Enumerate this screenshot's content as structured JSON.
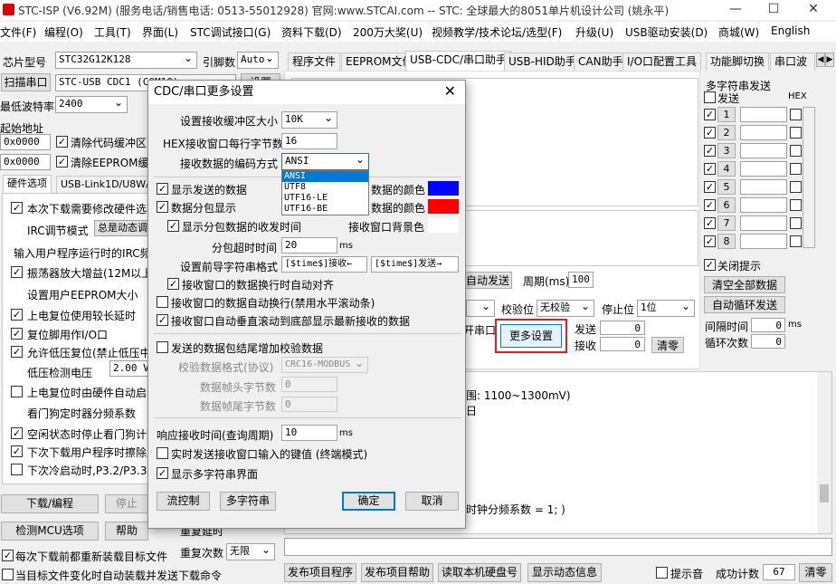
{
  "window": {
    "title": "STC-ISP (V6.92M) (服务电话/销售电话: 0513-55012928) 官网:www.STCAI.com  -- STC: 全球最大的8051单片机设计公司 (姚永平)",
    "min": "—",
    "max": "☐",
    "close": "✕"
  },
  "menu": [
    "文件(F)",
    "编程(O)",
    "工具(T)",
    "界面(L)",
    "STC调试接口(G)",
    "资料下载(D)",
    "200万大奖(U)",
    "视频教学/技术论坛/选型(F)",
    "升级(U)",
    "USB驱动安装(D)",
    "商城(W)",
    "English"
  ],
  "left": {
    "chip_label": "芯片型号",
    "chip_value": "STC32G12K128",
    "pin_label": "引脚数",
    "pin_value": "Auto",
    "scan_btn": "扫描串口",
    "port_value": "STC-USB CDC1 (COM10)",
    "setup_btn": "设置",
    "baud_label": "最低波特率",
    "baud_value": "2400",
    "start_label": "起始地址",
    "addr1": "0x0000",
    "clear_code": "清除代码缓冲区",
    "addr2": "0x0000",
    "clear_eeprom": "清除EEPROM缓冲区",
    "hw_tab": "硬件选项",
    "usb_tab": "USB-Link1D/U8W/U",
    "opts": [
      {
        "t": "本次下载需要修改硬件选项",
        "c": true
      },
      {
        "t": "IRC调节模式",
        "c": null
      },
      {
        "t": "输入用户程序运行时的IRC频率",
        "c": null
      },
      {
        "t": "振荡器放大增益(12M以上建议)",
        "c": true
      },
      {
        "t": "设置用户EEPROM大小",
        "c": null
      },
      {
        "t": "上电复位使用较长延时",
        "c": true
      },
      {
        "t": "复位脚用作I/O口",
        "c": true
      },
      {
        "t": "允许低压复位(禁止低压中断)",
        "c": true
      },
      {
        "t": "低压检测电压",
        "c": null
      },
      {
        "t": "上电复位时由硬件自动启动看门狗",
        "c": false
      },
      {
        "t": "看门狗定时器分频系数",
        "c": null
      },
      {
        "t": "空闲状态时停止看门狗计数",
        "c": true
      },
      {
        "t": "下次下载用户程序时擦除用户EEPROM区",
        "c": true
      },
      {
        "t": "下次冷启动时,P3.2/P3.3为0/0才可下载程序",
        "c": false
      }
    ],
    "irc_mode": "总是动态调节",
    "lvd_value": "2.00 V",
    "download_btn": "下载/编程",
    "stop_btn": "停止",
    "detect_btn": "检测MCU选项",
    "help_btn": "帮助",
    "retry_delay_label": "重复延时",
    "retry_count_label": "重复次数",
    "retry_count_value": "无限",
    "reload_chk": "每次下载前都重新装载目标文件",
    "auto_send_chk": "当目标文件变化时自动装载并发送下载命令"
  },
  "tabs": [
    "程序文件",
    "EEPROM文件",
    "USB-CDC/串口助手",
    "USB-HID助手",
    "CAN助手",
    "I/O口配置工具",
    "功能脚切换",
    "串口波"
  ],
  "main": {
    "hint": "...",
    "auto_send_btn": "自动发送",
    "period_label": "周期(ms)",
    "period_value": "100",
    "parity_label": "校验位",
    "parity_value": "无校验",
    "stop_label": "停止位",
    "stop_value": "1位",
    "open_port": "开串口",
    "more_btn": "更多设置",
    "send_label": "发送",
    "send_count": "0",
    "recv_label": "接收",
    "recv_count": "0",
    "clear_btn": "清零",
    "log1": "围: 1100~1300mV)",
    "log2": "日",
    "log3": "时钟分频系数 = 1; )"
  },
  "multi": {
    "title": "多字符串发送",
    "send_h": "发送",
    "hex_h": "HEX",
    "rows": [
      "1",
      "2",
      "3",
      "4",
      "5",
      "6",
      "7",
      "8"
    ],
    "close_tip": "关闭提示",
    "clear_all": "清空全部数据",
    "auto_loop": "自动循环发送",
    "interval_label": "间隔时间",
    "interval_value": "0",
    "interval_unit": "ms",
    "loop_label": "循环次数",
    "loop_value": "0"
  },
  "bottom": {
    "publish_prog": "发布项目程序",
    "publish_help": "发布项目帮助",
    "read_disk": "读取本机硬盘号",
    "show_dyn": "显示动态信息",
    "beep": "提示音",
    "success_label": "成功计数",
    "success_value": "67",
    "clear_btn": "清零"
  },
  "dialog": {
    "title": "CDC/串口更多设置",
    "close": "✕",
    "buf_label": "设置接收缓冲区大小",
    "buf_value": "10K",
    "hex_label": "HEX接收窗口每行字节数",
    "hex_value": "16",
    "enc_label": "接收数据的编码方式",
    "enc_value": "ANSI",
    "enc_options": [
      "ANSI",
      "UTF8",
      "UTF16-LE",
      "UTF16-BE"
    ],
    "show_sent": "显示发送的数据",
    "sent_color_label": "数据的颜色",
    "split": "数据分包显示",
    "recv_color_label": "数据的颜色",
    "show_time": "显示分包数据的收发时间",
    "bg_label": "接收窗口背景色",
    "timeout_label": "分包超时时间",
    "timeout_value": "20",
    "timeout_unit": "ms",
    "prefix_label": "设置前导字符串格式",
    "prefix_recv": "[$time$]接收←",
    "prefix_send": "[$time$]发送→",
    "align": "接收窗口的数据换行时自动对齐",
    "wrap": "接收窗口的数据自动换行(禁用水平滚动条)",
    "autoscroll": "接收窗口自动垂直滚动到底部显示最新接收的数据",
    "checksum": "发送的数据包结尾增加校验数据",
    "fmt_label": "校验数据格式(协议)",
    "fmt_value": "CRC16-MODBUS",
    "head_label": "数据帧头字节数",
    "head_value": "0",
    "tail_label": "数据帧尾字节数",
    "tail_value": "0",
    "resp_label": "响应接收时间(查询周期)",
    "resp_value": "10",
    "resp_unit": "ms",
    "realtime": "实时发送接收窗口输入的键值 (终端模式)",
    "multi": "显示多字符串界面",
    "flow_btn": "流控制",
    "multi_btn": "多字符串",
    "ok_btn": "确定",
    "cancel_btn": "取消",
    "sent_color": "#0000ff",
    "recv_color": "#ff0000"
  }
}
